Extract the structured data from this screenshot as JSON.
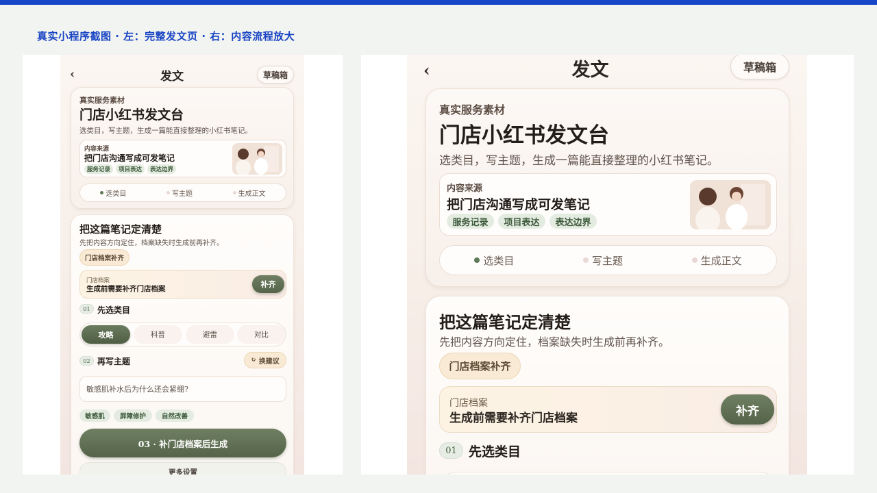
{
  "caption": "真实小程序截图 · 左：完整发文页 · 右：内容流程放大",
  "nav": {
    "back": "‹",
    "title": "发文",
    "drafts": "草稿箱"
  },
  "hero": {
    "eyebrow": "真实服务素材",
    "title": "门店小红书发文台",
    "subtitle": "选类目，写主题，生成一篇能直接整理的小红书笔记。",
    "source": {
      "label": "内容来源",
      "title": "把门店沟通写成可发笔记",
      "tags": [
        "服务记录",
        "项目表达",
        "表达边界"
      ]
    },
    "steps": [
      "选类目",
      "写主题",
      "生成正文"
    ]
  },
  "define": {
    "title": "把这篇笔记定清楚",
    "subtitle": "先把内容方向定住，档案缺失时生成前再补齐。",
    "badge": "门店档案补齐",
    "archive": {
      "label": "门店档案",
      "text": "生成前需要补齐门店档案",
      "action": "补齐"
    }
  },
  "category": {
    "num": "01",
    "title": "先选类目",
    "options": [
      "攻略",
      "科普",
      "避雷",
      "对比"
    ],
    "selected": "攻略"
  },
  "topic": {
    "num": "02",
    "title": "再写主题",
    "refresh_icon": "refresh-icon",
    "refresh": "换建议",
    "value": "敏感肌补水后为什么还会紧绷?",
    "tags": [
      "敏感肌",
      "屏障修护",
      "自然改善"
    ]
  },
  "generate": {
    "label": "03 ·  补门店档案后生成"
  },
  "more": {
    "label": "更多设置"
  },
  "colors": {
    "accent": "#1746c9",
    "green": "#5f7a58",
    "gold": "#f8ead4"
  }
}
